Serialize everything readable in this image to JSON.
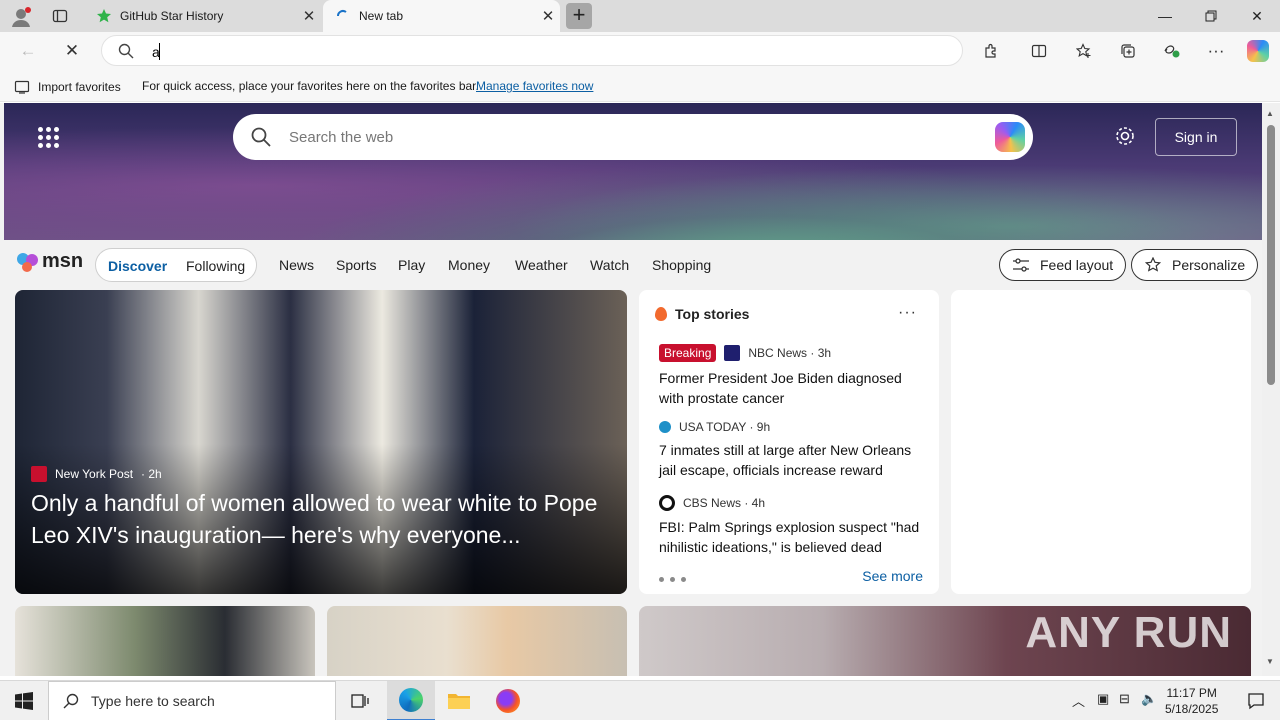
{
  "tabs": [
    {
      "title": "GitHub Star History",
      "close_icon": "close-icon"
    },
    {
      "title": "New tab",
      "close_icon": "close-icon"
    }
  ],
  "address_bar": {
    "value": "a"
  },
  "favorites_bar": {
    "import_label": "Import favorites",
    "hint": "For quick access, place your favorites here on the favorites bar.",
    "manage_link": "Manage favorites now"
  },
  "hero": {
    "search_placeholder": "Search the web",
    "sign_in": "Sign in"
  },
  "msn_nav": {
    "logo_text": "msn",
    "discover": "Discover",
    "following": "Following",
    "links": [
      "News",
      "Sports",
      "Play",
      "Money",
      "Weather",
      "Watch",
      "Shopping"
    ],
    "feed_layout": "Feed layout",
    "personalize": "Personalize"
  },
  "feature": {
    "source": "New York Post",
    "age": "· 2h",
    "headline": "Only a handful of women allowed to wear white to Pope Leo XIV's inauguration— here's why everyone..."
  },
  "top_stories": {
    "header": "Top stories",
    "stories": [
      {
        "badge": "Breaking",
        "source": "NBC News · 3h",
        "title": "Former President Joe Biden diagnosed with prostate cancer",
        "icon_color": "#1f1f6e"
      },
      {
        "badge": "",
        "source": "USA TODAY · 9h",
        "title": "7 inmates still at large after New Orleans jail escape, officials increase reward",
        "icon_color": "#1e90c8"
      },
      {
        "badge": "",
        "source": "CBS News · 4h",
        "title": "FBI: Palm Springs explosion suspect \"had nihilistic ideations,\" is believed dead",
        "icon_color": "#111111"
      }
    ],
    "see_more": "See more"
  },
  "watermark": "ANY RUN",
  "taskbar": {
    "search_placeholder": "Type here to search",
    "time": "11:17 PM",
    "date": "5/18/2025"
  },
  "colors": {
    "accent": "#0c5fa3",
    "breaking": "#c8102e"
  }
}
